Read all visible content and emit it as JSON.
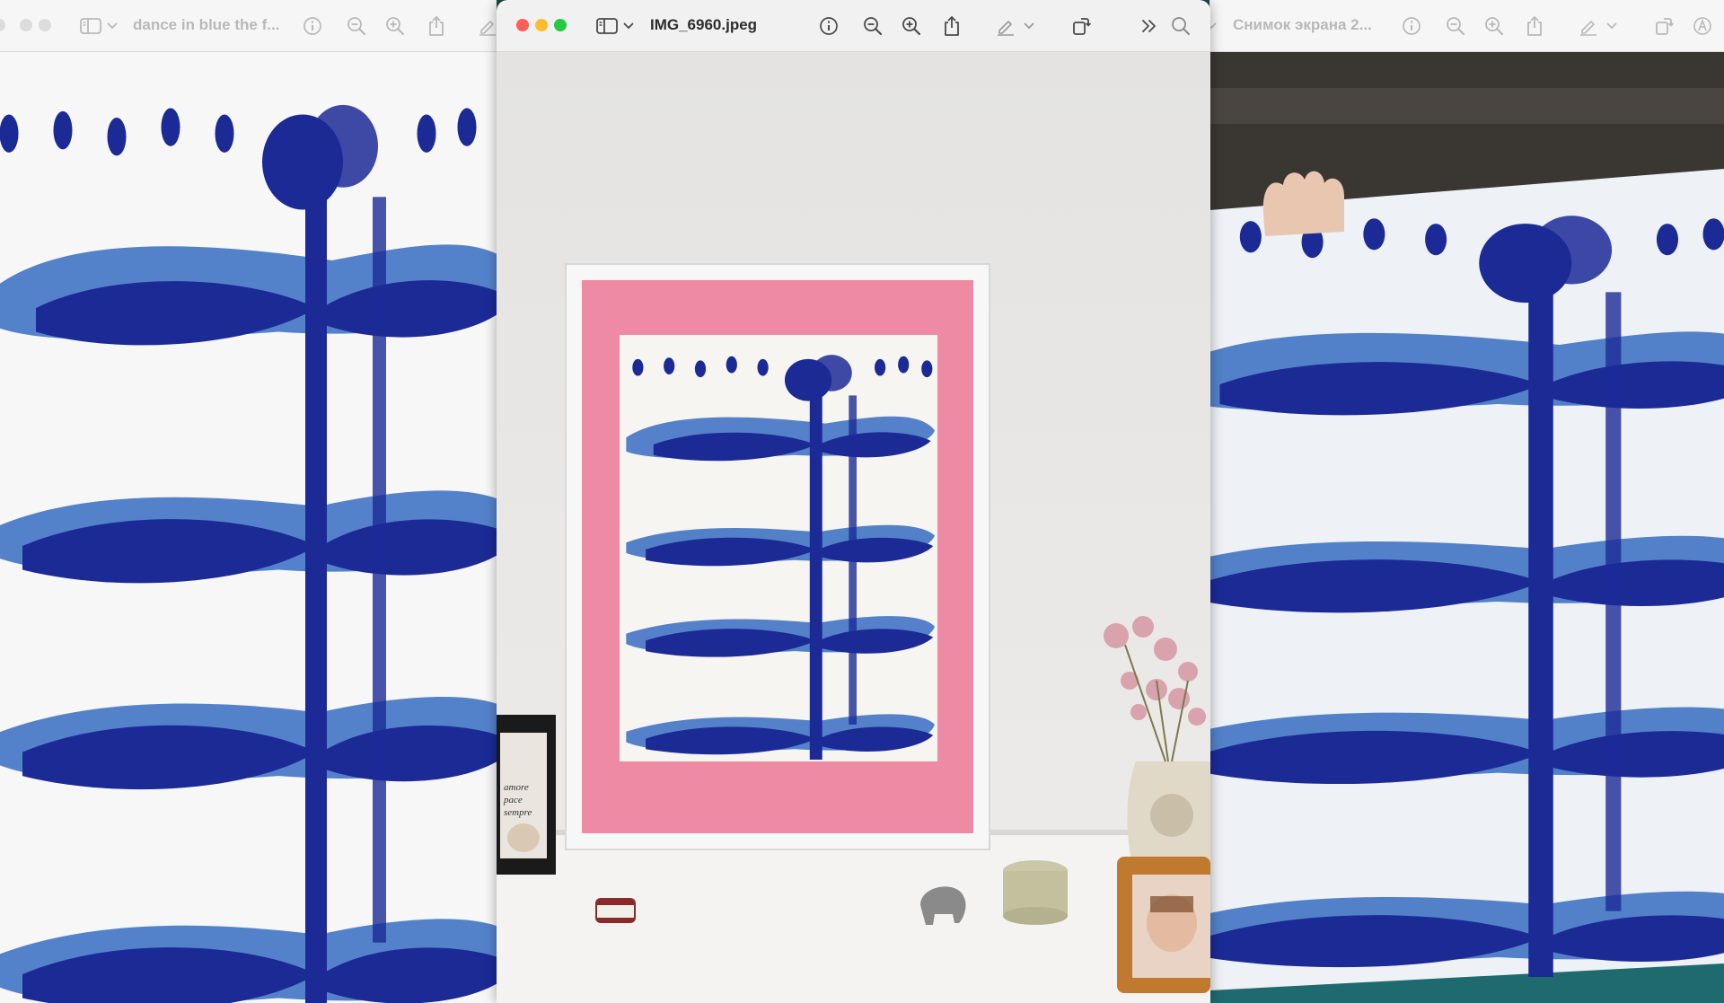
{
  "windows": {
    "left": {
      "title": "dance in blue the f..."
    },
    "main": {
      "title": "IMG_6960.jpeg"
    },
    "right": {
      "title": "Снимок экрана 2..."
    }
  },
  "photo_book": {
    "lines": [
      "amore",
      "pace",
      "sempre"
    ]
  },
  "colors": {
    "accent_pink": "#ef8aa5",
    "ink_blue": "#1f2f8f",
    "ink_light": "#3a6fc4",
    "close": "#fe5f57",
    "minimize": "#febc2e",
    "zoom": "#28c840"
  },
  "icons": {
    "toolbar": [
      "sidebar-icon",
      "chevron-down-icon",
      "info-icon",
      "zoom-out-icon",
      "zoom-in-icon",
      "share-icon",
      "markup-icon",
      "rotate-icon",
      "more-icon",
      "search-icon"
    ]
  }
}
